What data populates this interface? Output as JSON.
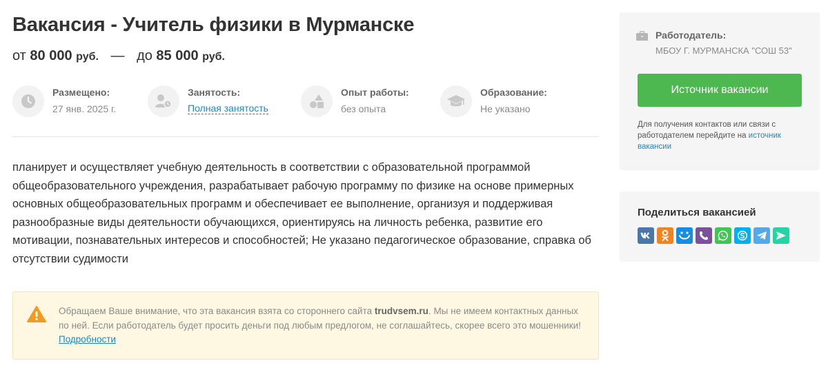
{
  "vacancy": {
    "title": "Вакансия - Учитель физики в Мурманске",
    "salary": {
      "from_word": "от",
      "from_value": "80 000",
      "currency": "руб.",
      "dash": "—",
      "to_word": "до",
      "to_value": "85 000"
    },
    "facts": [
      {
        "label": "Размещено:",
        "value": "27 янв. 2025 г.",
        "icon": "clock-icon"
      },
      {
        "label": "Занятость:",
        "value": "Полная занятость",
        "icon": "people-icon"
      },
      {
        "label": "Опыт работы:",
        "value": "без опыта",
        "icon": "shapes-icon"
      },
      {
        "label": "Образование:",
        "value": "Не указано",
        "icon": "graduation-cap-icon"
      }
    ],
    "description": "планирует и осуществляет учебную деятельность в соответствии с образовательной программой общеобразовательного учреждения, разрабатывает рабочую программу по физике на основе примерных основных общеобразовательных программ и обеспечивает ее выполнение, организуя и поддерживая разнообразные виды деятельности обучающихся, ориентируясь на личность ребенка, развитие его мотивации, познавательных интересов и способностей; Не указано педагогическое образование, справка об отсутствии судимости"
  },
  "notice": {
    "text_before": "Обращаем Ваше внимание, что эта вакансия взята со стороннего сайта ",
    "site": "trudvsem.ru",
    "text_after": ". Мы не имеем контактных данных по ней. Если работодатель будет просить деньги под любым предлогом, не соглашайтесь, скорее всего это мошенники! ",
    "link": "Подробности"
  },
  "employer": {
    "label": "Работодатель:",
    "name": "МБОУ Г. МУРМАНСКА \"СОШ 53\"",
    "source_button": "Источник вакансии",
    "hint_text": "Для получения контактов или связи с работодателем перейдите на ",
    "hint_link": "источник вакансии"
  },
  "share": {
    "title": "Поделиться вакансией",
    "networks": [
      {
        "name": "vk",
        "color": "#4a76a8",
        "glyph": "vk"
      },
      {
        "name": "odnoklassniki",
        "color": "#f58220",
        "glyph": "ok"
      },
      {
        "name": "moi-mir",
        "color": "#168de2",
        "glyph": "mm"
      },
      {
        "name": "viber",
        "color": "#7b519d",
        "glyph": "vb"
      },
      {
        "name": "whatsapp",
        "color": "#43c553",
        "glyph": "wa"
      },
      {
        "name": "skype",
        "color": "#00aff0",
        "glyph": "sk"
      },
      {
        "name": "telegram",
        "color": "#54a9eb",
        "glyph": "tg"
      },
      {
        "name": "send",
        "color": "#25d4a3",
        "glyph": "sd"
      }
    ]
  },
  "colors": {
    "accent_green": "#4cb84f",
    "link_blue": "#1a8ac4",
    "warning_orange": "#f29b20",
    "notice_bg": "#fef8e3"
  }
}
